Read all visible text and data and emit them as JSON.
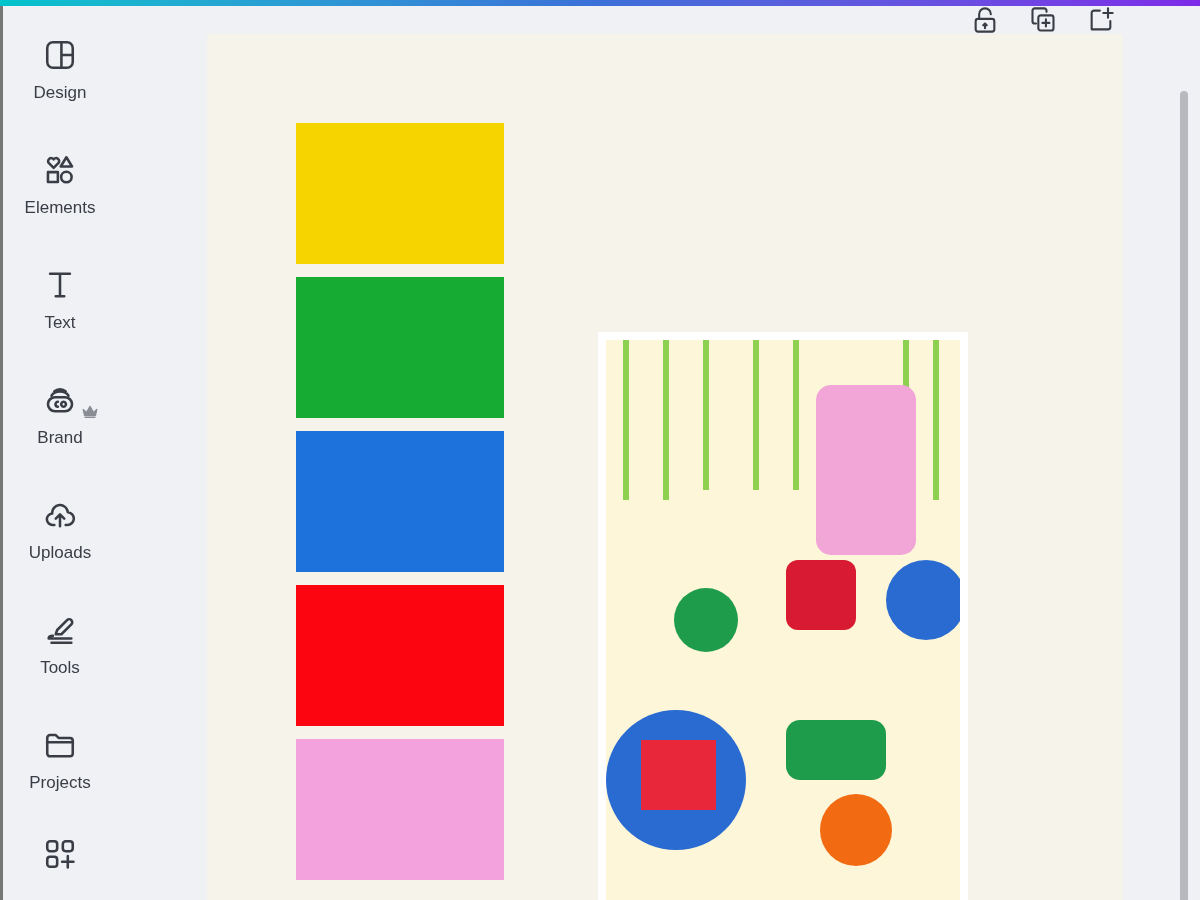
{
  "sidebar": {
    "items": [
      {
        "label": "Design",
        "premium": false
      },
      {
        "label": "Elements",
        "premium": false
      },
      {
        "label": "Text",
        "premium": false
      },
      {
        "label": "Brand",
        "premium": true
      },
      {
        "label": "Uploads",
        "premium": false
      },
      {
        "label": "Tools",
        "premium": false
      },
      {
        "label": "Projects",
        "premium": false
      }
    ]
  },
  "canvas": {
    "swatches": [
      {
        "color": "#f5d400"
      },
      {
        "color": "#16ac33"
      },
      {
        "color": "#1d72dc"
      },
      {
        "color": "#fd0510"
      },
      {
        "color": "#f4a2dd"
      }
    ]
  }
}
